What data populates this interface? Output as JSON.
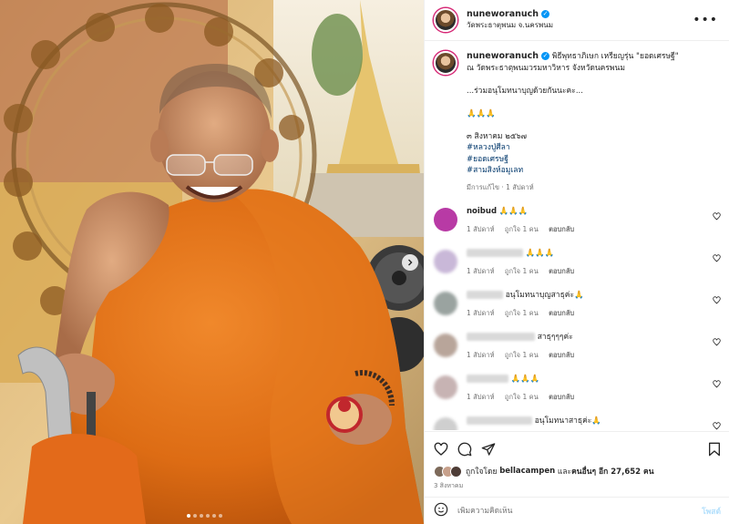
{
  "post": {
    "username": "nuneworanuch",
    "location": "วัดพระธาตุพนม จ.นครพนม",
    "image_alt": "พระสงฆ์ห่มจีวรสีส้มยิ้มนั่งบนรถเข็น",
    "carousel": {
      "count": 6,
      "active_index": 0
    }
  },
  "caption": {
    "username": "nuneworanuch",
    "lines": [
      "พิธีพุทธาภิเษก เหรียญรุ่น \"ยอดเศรษฐี\"",
      "ณ วัดพระธาตุพนมวรมหาวิหาร จังหวัดนครพนม",
      "",
      "...ร่วมอนุโมทนาบุญด้วยกันนะคะ...",
      "",
      "🙏🙏🙏",
      "",
      "๓ สิงหาคม ๒๕๖๗"
    ],
    "hashtags": [
      "#หลวงปู่ศีลา",
      "#ยอดเศรษฐี",
      "#สามสิงห์อมูเลท"
    ],
    "meta": "มีการแก้ไข · 1 สัปดาห์"
  },
  "comments": [
    {
      "name": "noibud",
      "text": "🙏🙏🙏",
      "time": "1 สัปดาห์",
      "likes": "ถูกใจ 1 คน",
      "reply": "ตอบกลับ",
      "avatar_color": "#b83aa5",
      "blur_name": false
    },
    {
      "name": "",
      "text": "🙏🙏🙏",
      "time": "1 สัปดาห์",
      "likes": "ถูกใจ 1 คน",
      "reply": "ตอบกลับ",
      "avatar_color": "#c9b8d8",
      "blur_name": true
    },
    {
      "name": "",
      "text": "อนุโมทนาบุญสาธุค่ะ🙏",
      "time": "1 สัปดาห์",
      "likes": "ถูกใจ 1 คน",
      "reply": "ตอบกลับ",
      "avatar_color": "#9aa3a0",
      "blur_name": true
    },
    {
      "name": "",
      "text": "สาธุๆๆๆค่ะ",
      "time": "1 สัปดาห์",
      "likes": "ถูกใจ 1 คน",
      "reply": "ตอบกลับ",
      "avatar_color": "#b8a59a",
      "blur_name": true
    },
    {
      "name": "",
      "text": "🙏🙏🙏",
      "time": "1 สัปดาห์",
      "likes": "ถูกใจ 1 คน",
      "reply": "ตอบกลับ",
      "avatar_color": "#c7b3b3",
      "blur_name": true
    },
    {
      "name": "",
      "text": "อนุโมทนาสาธุค่ะ🙏",
      "time": "1 สัปดาห์",
      "likes": "ถูกใจ 1 คน",
      "reply": "ตอบกลับ",
      "avatar_color": "#cfcfcf",
      "blur_name": true
    }
  ],
  "likes": {
    "prefix": "ถูกใจโดย",
    "by": "bellacampen",
    "middle": "และ",
    "others": "คนอื่นๆ อีก 27,652 คน"
  },
  "date": "3 สิงหาคม",
  "add_comment": {
    "placeholder": "เพิ่มความคิดเห็น",
    "post_label": "โพสต์"
  },
  "colors": {
    "accent": "#0095f6",
    "robe": "#e07419",
    "link": "#00376b"
  }
}
